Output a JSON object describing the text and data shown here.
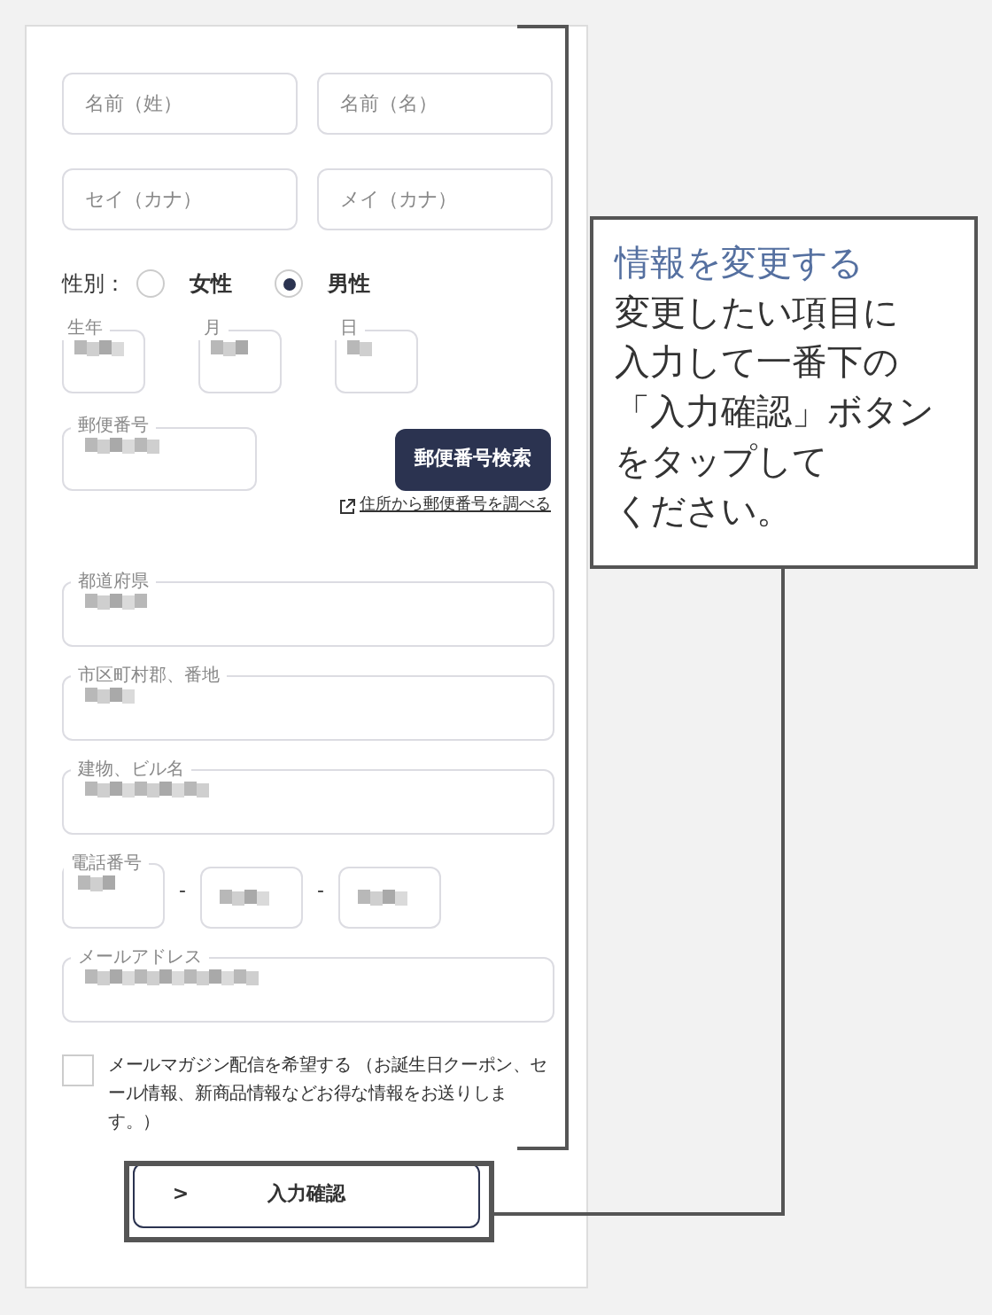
{
  "form": {
    "name_fields": [
      {
        "placeholder": "名前（姓）"
      },
      {
        "placeholder": "名前（名）"
      }
    ],
    "kana_fields": [
      {
        "placeholder": "セイ（カナ）"
      },
      {
        "placeholder": "メイ（カナ）"
      }
    ],
    "gender": {
      "label": "性別：",
      "options": [
        {
          "label": "女性",
          "selected": false
        },
        {
          "label": "男性",
          "selected": true
        }
      ]
    },
    "birth_fields": [
      {
        "label": "生年"
      },
      {
        "label": "月"
      },
      {
        "label": "日"
      }
    ],
    "postal": {
      "label": "郵便番号",
      "button": "郵便番号検索",
      "link": "住所から郵便番号を調べる"
    },
    "address_fields": [
      {
        "label": "都道府県"
      },
      {
        "label": "市区町村郡、番地"
      },
      {
        "label": "建物、ビル名"
      }
    ],
    "phone": {
      "label": "電話番号",
      "separators": [
        "-",
        "-"
      ]
    },
    "email": {
      "label": "メールアドレス"
    },
    "newsletter": {
      "checked": false,
      "label": "メールマガジン配信を希望する （お誕生日クーポン、セール情報、新商品情報などお得な情報をお送りします。）"
    },
    "submit": {
      "label": "入力確認",
      "icon": ">"
    }
  },
  "callout": {
    "title": "情報を変更する",
    "body_lines": [
      "変更したい項目に",
      "入力して一番下の",
      "「入力確認」ボタン",
      "をタップして",
      "ください。"
    ]
  }
}
